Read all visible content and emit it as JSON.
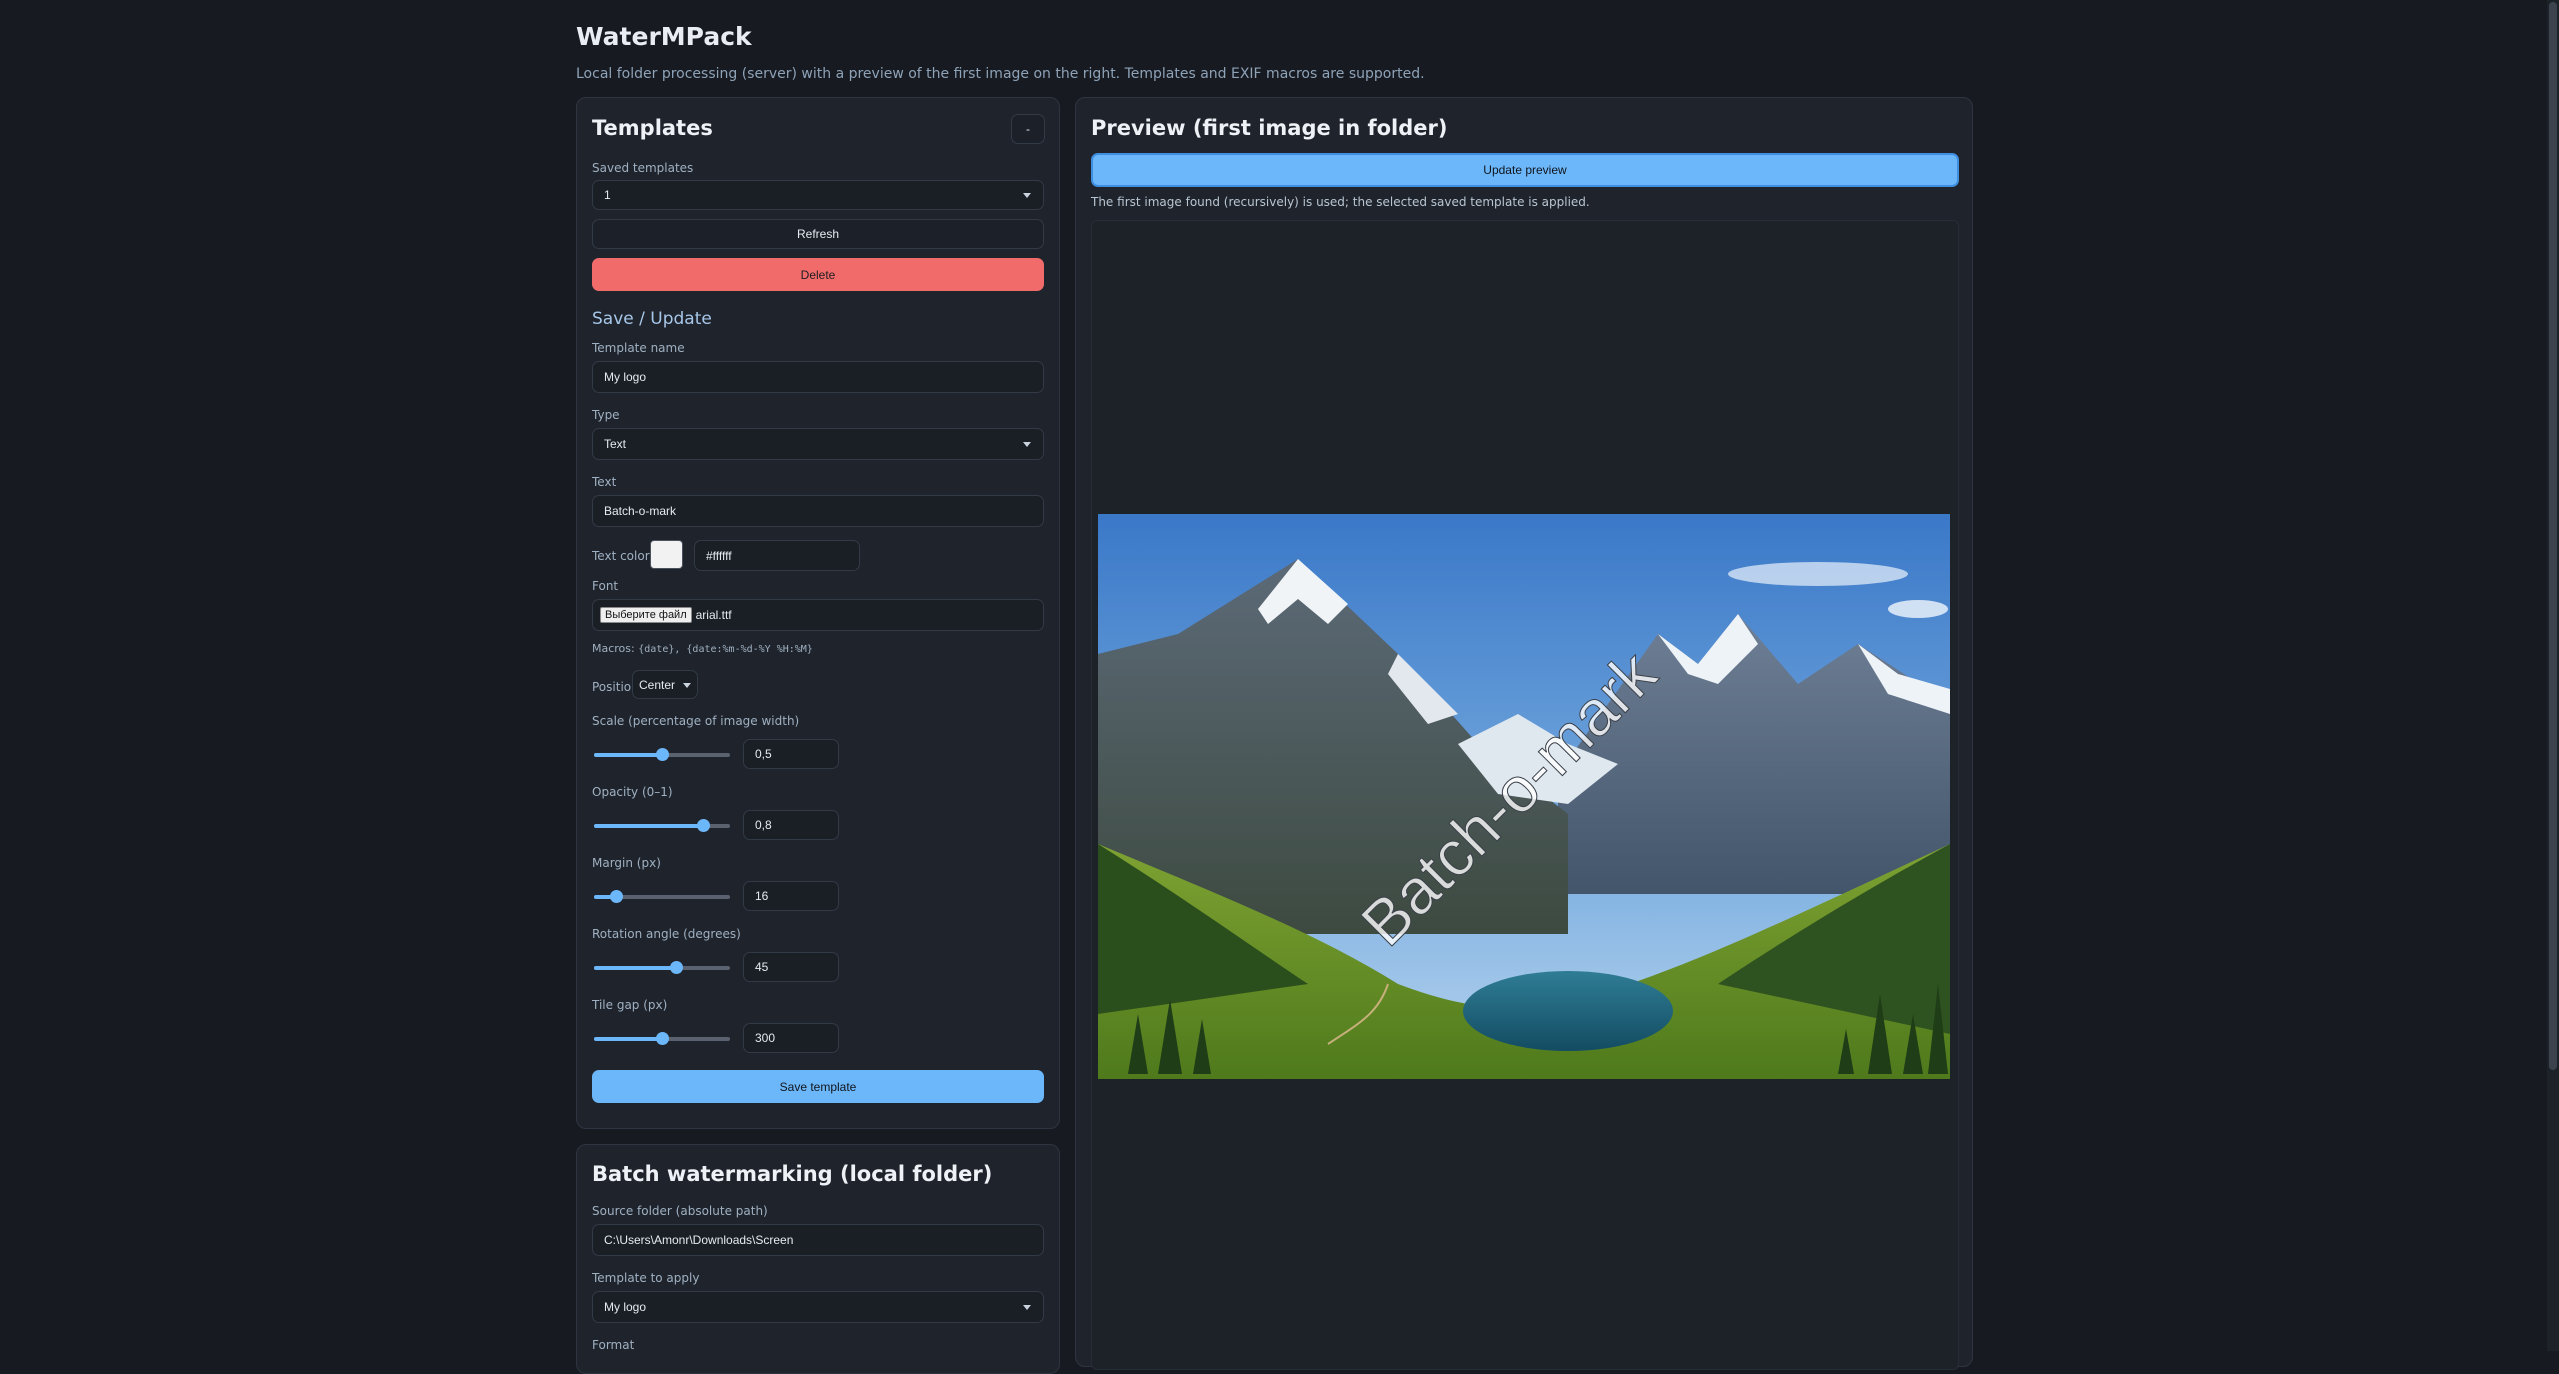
{
  "app": {
    "title": "WaterMPack",
    "subtitle": "Local folder processing (server) with a preview of the first image on the right. Templates and EXIF macros are supported."
  },
  "templates": {
    "title": "Templates",
    "collapse_label": "-",
    "saved_label": "Saved templates",
    "saved_value": "1",
    "refresh_label": "Refresh",
    "delete_label": "Delete"
  },
  "save_update": {
    "title": "Save / Update",
    "name_label": "Template name",
    "name_value": "My logo",
    "type_label": "Type",
    "type_value": "Text",
    "text_label": "Text",
    "text_value": "Batch-o-mark",
    "color_label": "Text color",
    "color_value": "#ffffff",
    "font_label": "Font",
    "file_button": "Выберите файл",
    "file_name": "arial.ttf",
    "macros_prefix": "Macros:",
    "macros_list": "{date}, {date:%m-%d-%Y %H:%M}",
    "position_label": "Position",
    "position_value": "Center",
    "scale_label": "Scale (percentage of image width)",
    "scale_value": "0,5",
    "scale_level": 0.5,
    "opacity_label": "Opacity (0–1)",
    "opacity_value": "0,8",
    "opacity_level": 0.8,
    "margin_label": "Margin (px)",
    "margin_value": "16",
    "margin_level": 0.16,
    "rotation_label": "Rotation angle (degrees)",
    "rotation_value": "45",
    "rotation_level": 0.6,
    "tile_label": "Tile gap (px)",
    "tile_value": "300",
    "tile_level": 0.5,
    "save_label": "Save template"
  },
  "batch": {
    "title": "Batch watermarking (local folder)",
    "source_label": "Source folder (absolute path)",
    "source_value": "C:\\Users\\Amonr\\Downloads\\Screen",
    "template_label": "Template to apply",
    "template_value": "My logo",
    "format_label": "Format"
  },
  "preview": {
    "title": "Preview (first image in folder)",
    "update_label": "Update preview",
    "note": "The first image found (recursively) is used; the selected saved template is applied.",
    "watermark_text": "Batch-o-mark"
  },
  "colors": {
    "accent": "#6cb6fa",
    "danger": "#f26b6b",
    "background": "#171b21",
    "card": "#1f242c"
  }
}
